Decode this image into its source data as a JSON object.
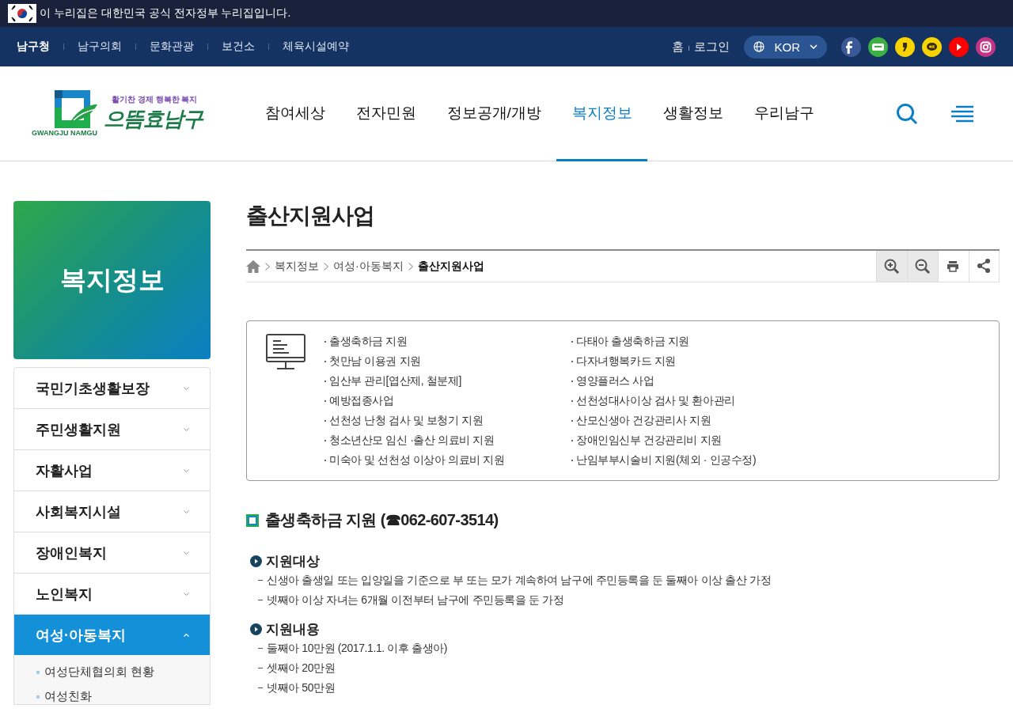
{
  "gov_banner": {
    "text": "이 누리집은 대한민국 공식 전자정부 누리집입니다."
  },
  "top_bar": {
    "sites": [
      {
        "label": "남구청",
        "selected": true
      },
      {
        "label": "남구의회",
        "selected": false
      },
      {
        "label": "문화관광",
        "selected": false
      },
      {
        "label": "보건소",
        "selected": false
      },
      {
        "label": "체육시설예약",
        "selected": false
      }
    ],
    "links": [
      "홈",
      "로그인"
    ],
    "language": "KOR",
    "social": [
      {
        "kind": "facebook",
        "color": "#3b5998"
      },
      {
        "kind": "blog",
        "color": "#3cb043"
      },
      {
        "kind": "story",
        "color": "#f7d300"
      },
      {
        "kind": "channel",
        "color": "#f7d300"
      },
      {
        "kind": "youtube",
        "color": "#ff0000"
      },
      {
        "kind": "instagram",
        "color": "#c13584"
      }
    ]
  },
  "header": {
    "logo": {
      "tagline": "활기찬 경제 행복한 복지",
      "name": "으뜸효남구",
      "sub": "GWANGJU NAMGU"
    },
    "nav": [
      {
        "label": "참여세상",
        "selected": false
      },
      {
        "label": "전자민원",
        "selected": false
      },
      {
        "label": "정보공개/개방",
        "selected": false
      },
      {
        "label": "복지정보",
        "selected": true
      },
      {
        "label": "생활정보",
        "selected": false
      },
      {
        "label": "우리남구",
        "selected": false
      }
    ]
  },
  "sidebar": {
    "title": "복지정보",
    "items": [
      {
        "label": "국민기초생활보장",
        "expanded": false
      },
      {
        "label": "주민생활지원",
        "expanded": false
      },
      {
        "label": "자활사업",
        "expanded": false
      },
      {
        "label": "사회복지시설",
        "expanded": false
      },
      {
        "label": "장애인복지",
        "expanded": false
      },
      {
        "label": "노인복지",
        "expanded": false
      },
      {
        "label": "여성·아동복지",
        "expanded": true,
        "children": [
          {
            "label": "여성단체협의회 현황"
          },
          {
            "label": "여성친화"
          }
        ]
      }
    ]
  },
  "content": {
    "title": "출산지원사업",
    "breadcrumb": [
      "복지정보",
      "여성·아동복지",
      "출산지원사업"
    ],
    "tools": [
      {
        "kind": "zoom-in"
      },
      {
        "kind": "zoom-out"
      },
      {
        "kind": "print"
      },
      {
        "kind": "share"
      }
    ],
    "quick_links": [
      [
        "출생축하금 지원",
        "첫만남 이용권 지원",
        "임산부 관리[엽산제, 철분제]",
        "예방접종사업",
        "선천성 난청 검사 및 보청기 지원",
        "청소년산모 임신 ·출산 의료비 지원",
        "미숙아 및 선천성 이상아 의료비 지원"
      ],
      [
        "다태아 출생축하금 지원",
        "다자녀행복카드 지원",
        "영양플러스 사업",
        "선천성대사이상 검사 및 환아관리",
        "산모신생아 건강관리사 지원",
        "장애인임신부 건강관리비 지원",
        "난임부부시술비 지원(체외 · 인공수정)"
      ]
    ],
    "section": {
      "title": "출생축하금 지원 (☎062-607-3514)",
      "subsections": [
        {
          "title": "지원대상",
          "items": [
            "신생아 출생일 또는 입양일을 기준으로 부 또는 모가 계속하여 남구에 주민등록을 둔 둘째아 이상 출산 가정",
            "넷째아 이상 자녀는 6개월 이전부터 남구에 주민등록을 둔 가정"
          ]
        },
        {
          "title": "지원내용",
          "items": [
            "둘째아 10만원 (2017.1.1. 이후 출생아)",
            "셋째아 20만원",
            "넷째아 50만원"
          ]
        }
      ]
    }
  }
}
